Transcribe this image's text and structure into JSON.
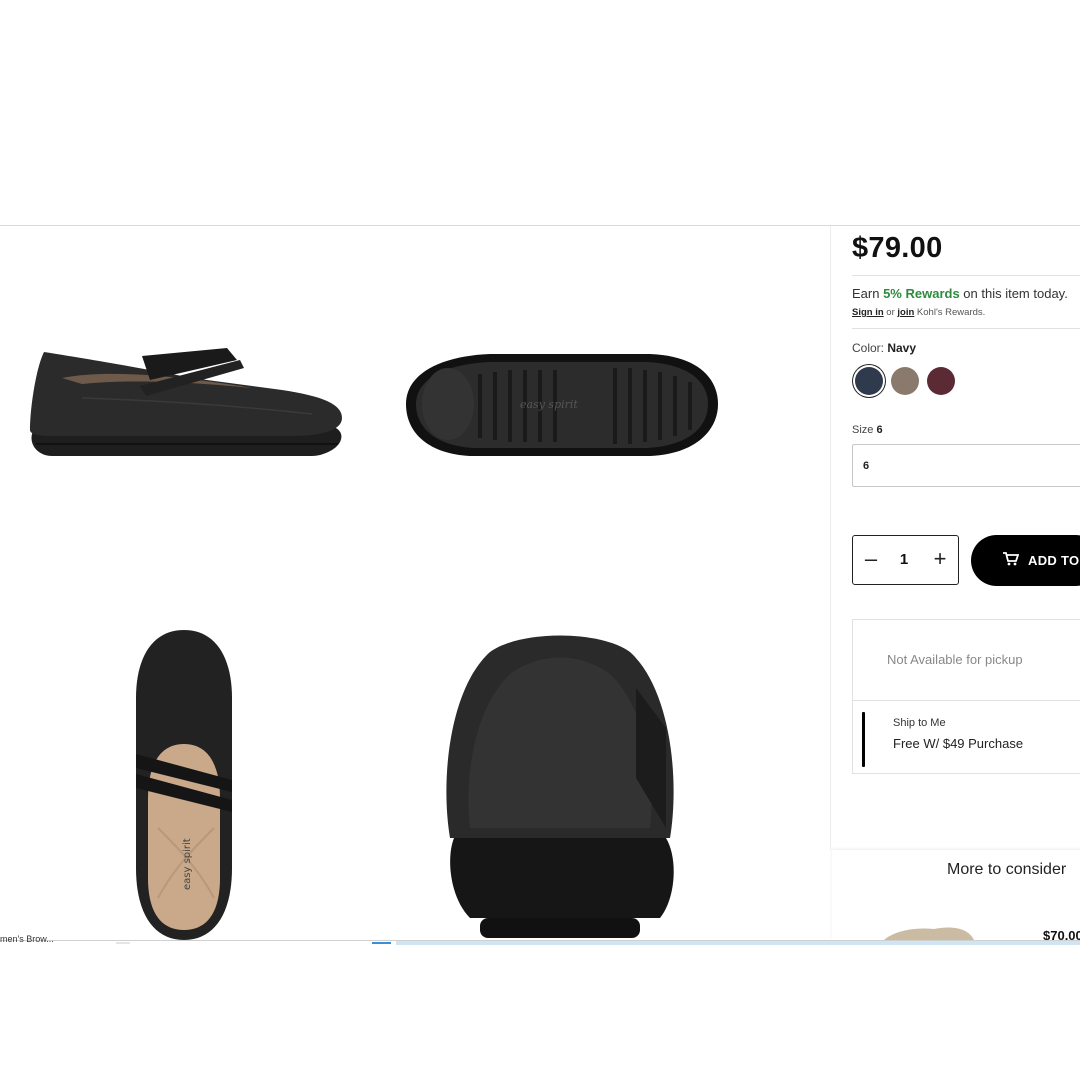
{
  "product": {
    "price": "$79.00",
    "rewards": {
      "prefix": "Earn ",
      "highlight": "5% Rewards",
      "suffix": " on this item today.",
      "sign_in": "Sign in",
      "or": " or ",
      "join": "join",
      "program": " Kohl's Rewards."
    },
    "color": {
      "label": "Color: ",
      "selected": "Navy",
      "swatches": [
        {
          "name": "Navy",
          "color": "#2f3a4d"
        },
        {
          "name": "Taupe",
          "color": "#8a7a6d"
        },
        {
          "name": "Burgundy",
          "color": "#5b2a34"
        }
      ]
    },
    "size": {
      "label": "Size ",
      "selected": "6",
      "field_value": "6"
    },
    "quantity": {
      "minus": "–",
      "value": "1",
      "plus": "+"
    },
    "add_to_cart": "ADD TO CART",
    "fulfillment": {
      "pickup": "Not Available for pickup",
      "ship_title": "Ship to Me",
      "ship_sub": "Free W/ $49 Purchase"
    },
    "images": {
      "brand_mark": "easy spirit"
    }
  },
  "more": {
    "title": "More to consider",
    "price": "$70.00"
  },
  "taskbar": {
    "item": "men's Brow..."
  },
  "colors": {
    "accent_green": "#2e8b3d",
    "button_black": "#000000"
  }
}
